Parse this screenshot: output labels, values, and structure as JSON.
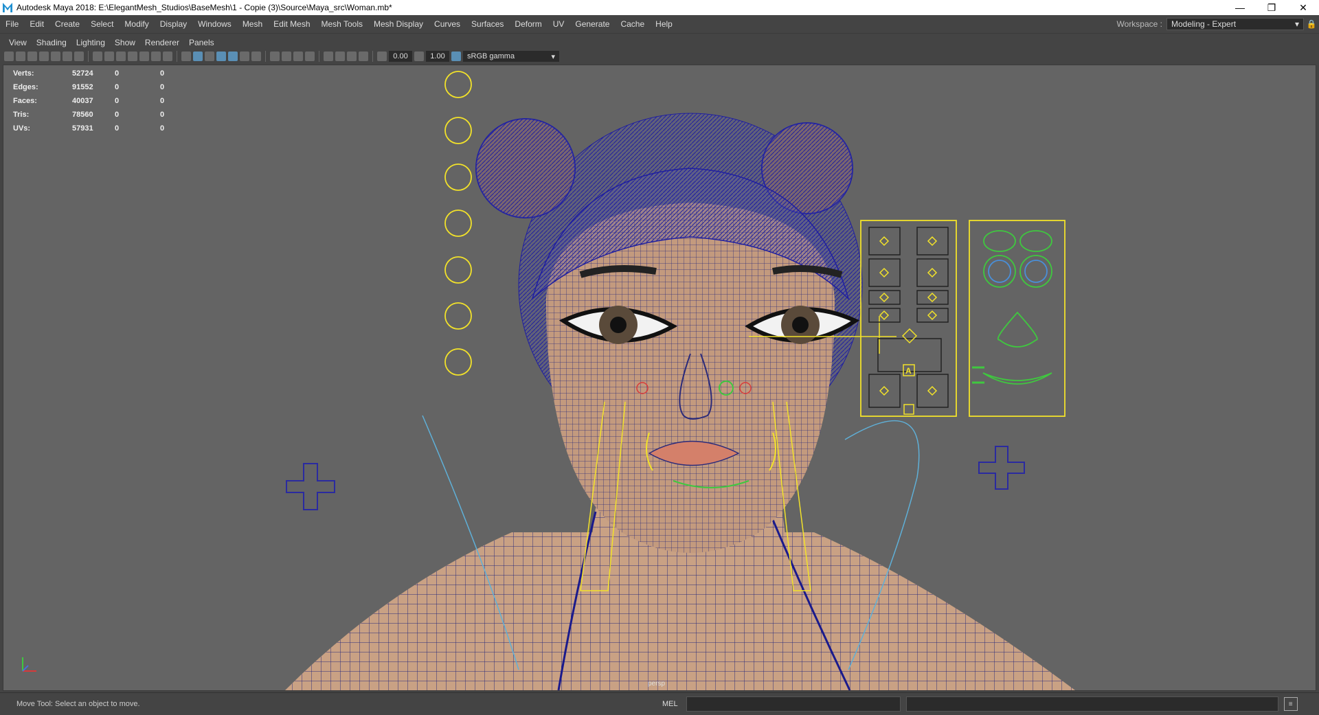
{
  "window": {
    "title": "Autodesk Maya 2018: E:\\ElegantMesh_Studios\\BaseMesh\\1 - Copie (3)\\Source\\Maya_src\\Woman.mb*",
    "minimize": "—",
    "restore": "❐",
    "close": "✕"
  },
  "menu": [
    "File",
    "Edit",
    "Create",
    "Select",
    "Modify",
    "Display",
    "Windows",
    "Mesh",
    "Edit Mesh",
    "Mesh Tools",
    "Mesh Display",
    "Curves",
    "Surfaces",
    "Deform",
    "UV",
    "Generate",
    "Cache",
    "Help"
  ],
  "workspace": {
    "label": "Workspace :",
    "value": "Modeling - Expert"
  },
  "panel_menu": [
    "View",
    "Shading",
    "Lighting",
    "Show",
    "Renderer",
    "Panels"
  ],
  "toolbar": {
    "exposure": "0.00",
    "gamma": "1.00",
    "colorspace": "sRGB gamma"
  },
  "hud": [
    {
      "label": "Verts:",
      "value": "52724",
      "sel": "0",
      "comp": "0"
    },
    {
      "label": "Edges:",
      "value": "91552",
      "sel": "0",
      "comp": "0"
    },
    {
      "label": "Faces:",
      "value": "40037",
      "sel": "0",
      "comp": "0"
    },
    {
      "label": "Tris:",
      "value": "78560",
      "sel": "0",
      "comp": "0"
    },
    {
      "label": "UVs:",
      "value": "57931",
      "sel": "0",
      "comp": "0"
    }
  ],
  "viewport": {
    "camera": "persp",
    "rig_label": "A"
  },
  "status": {
    "help": "Move Tool: Select an object to move.",
    "mel": "MEL"
  },
  "colors": {
    "wire": "#1a1a8c",
    "skin": "#c8a080",
    "control_yellow": "#f2e22a",
    "control_green": "#3fc83f",
    "control_blue": "#4a8fd8",
    "control_red": "#d83a3a",
    "viewport_bg": "#646464"
  }
}
